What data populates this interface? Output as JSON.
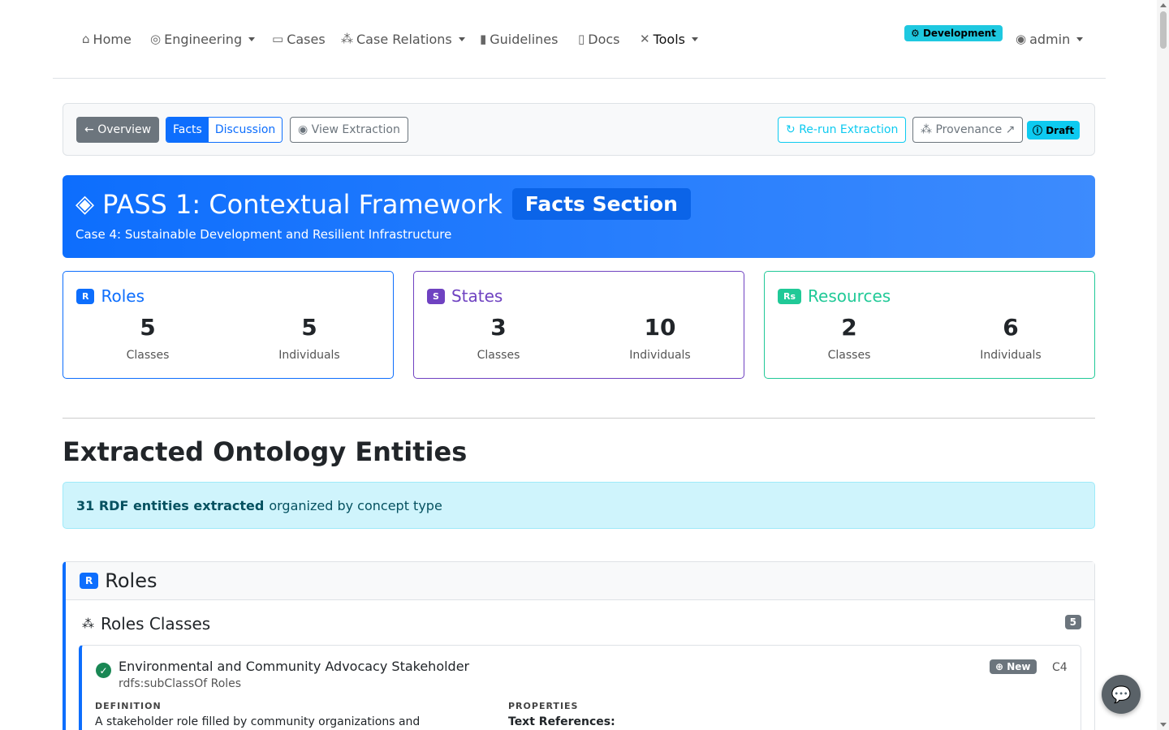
{
  "nav": {
    "home": "Home",
    "engineering": "Engineering",
    "cases": "Cases",
    "case_relations": "Case Relations",
    "guidelines": "Guidelines",
    "docs": "Docs",
    "tools": "Tools",
    "env": "Development",
    "user": "admin"
  },
  "toolbar": {
    "overview": "Overview",
    "facts": "Facts",
    "discussion": "Discussion",
    "view_extraction": "View Extraction",
    "rerun": "Re-run Extraction",
    "provenance": "Provenance",
    "draft": "Draft"
  },
  "hero": {
    "title": "PASS 1: Contextual Framework",
    "badge": "Facts Section",
    "subtitle": "Case 4: Sustainable Development and Resilient Infrastructure"
  },
  "summary": [
    {
      "tag": "R",
      "name": "Roles",
      "classes": "5",
      "individuals": "5",
      "color": "#0d6efd"
    },
    {
      "tag": "S",
      "name": "States",
      "classes": "3",
      "individuals": "10",
      "color": "#6f42c1"
    },
    {
      "tag": "Rs",
      "name": "Resources",
      "classes": "2",
      "individuals": "6",
      "color": "#20c997"
    }
  ],
  "labels": {
    "classes": "Classes",
    "individuals": "Individuals"
  },
  "section_title": "Extracted Ontology Entities",
  "alert": {
    "strong": "31 RDF entities extracted",
    "rest": "organized by concept type"
  },
  "panel": {
    "tag": "R",
    "title": "Roles",
    "sub_title": "Roles Classes",
    "count": "5"
  },
  "entity": {
    "label": "Environmental and Community Advocacy Stakeholder",
    "subclass": "rdfs:subClassOf Roles",
    "status": "New",
    "case": "C4",
    "def_header": "DEFINITION",
    "def_text": "A stakeholder role filled by community organizations and",
    "props_header": "PROPERTIES",
    "props_text": "Text References:"
  }
}
